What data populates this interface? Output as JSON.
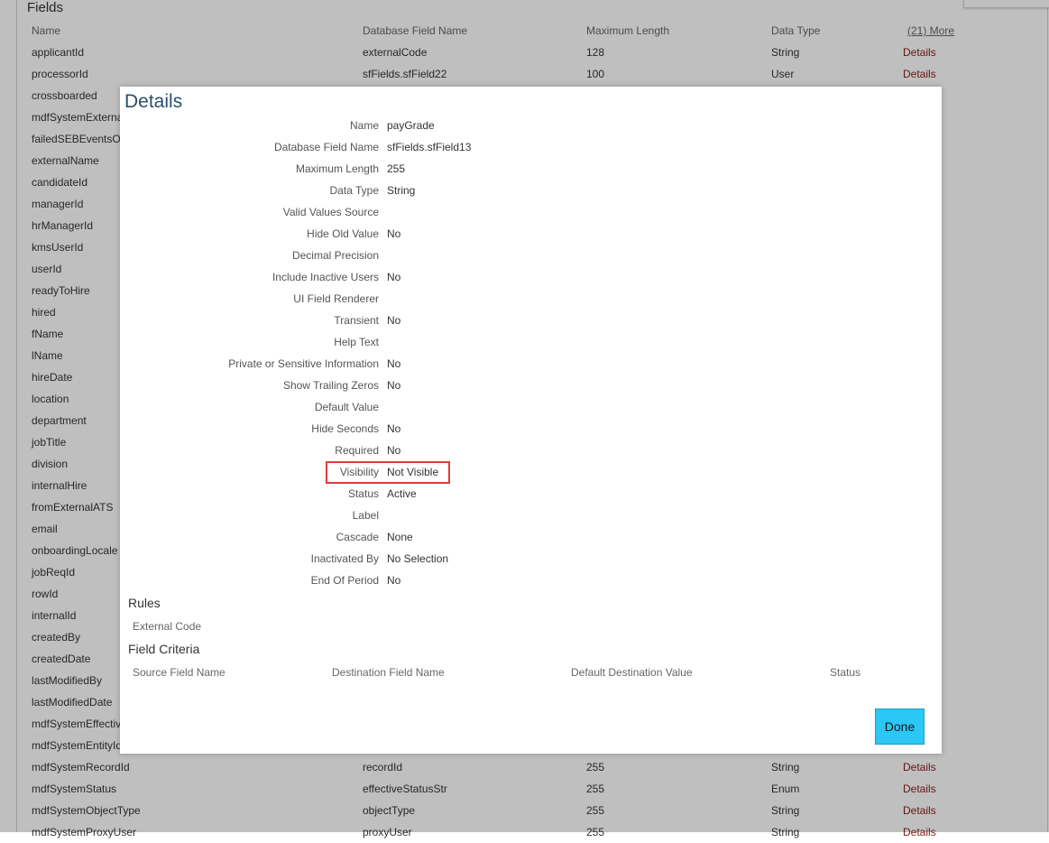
{
  "page": {
    "fields_title": "Fields",
    "headers": {
      "name": "Name",
      "db": "Database Field Name",
      "len": "Maximum Length",
      "type": "Data Type",
      "more": "(21) More"
    },
    "rows": [
      {
        "name": "applicantId",
        "db": "externalCode",
        "len": "128",
        "type": "String",
        "det": "Details"
      },
      {
        "name": "processorId",
        "db": "sfFields.sfField22",
        "len": "100",
        "type": "User",
        "det": "Details"
      },
      {
        "name": "crossboarded",
        "db": "",
        "len": "",
        "type": "",
        "det": ""
      },
      {
        "name": "mdfSystemExterna",
        "db": "",
        "len": "",
        "type": "",
        "det": ""
      },
      {
        "name": "failedSEBEventsOc",
        "db": "",
        "len": "",
        "type": "",
        "det": ""
      },
      {
        "name": "externalName",
        "db": "",
        "len": "",
        "type": "",
        "det": ""
      },
      {
        "name": "candidateId",
        "db": "",
        "len": "",
        "type": "",
        "det": ""
      },
      {
        "name": "managerId",
        "db": "",
        "len": "",
        "type": "",
        "det": ""
      },
      {
        "name": "hrManagerId",
        "db": "",
        "len": "",
        "type": "",
        "det": ""
      },
      {
        "name": "kmsUserId",
        "db": "",
        "len": "",
        "type": "",
        "det": ""
      },
      {
        "name": "userId",
        "db": "",
        "len": "",
        "type": "",
        "det": ""
      },
      {
        "name": "readyToHire",
        "db": "",
        "len": "",
        "type": "",
        "det": ""
      },
      {
        "name": "hired",
        "db": "",
        "len": "",
        "type": "",
        "det": ""
      },
      {
        "name": "fName",
        "db": "",
        "len": "",
        "type": "",
        "det": ""
      },
      {
        "name": "lName",
        "db": "",
        "len": "",
        "type": "",
        "det": ""
      },
      {
        "name": "hireDate",
        "db": "",
        "len": "",
        "type": "",
        "det": ""
      },
      {
        "name": "location",
        "db": "",
        "len": "",
        "type": "",
        "det": ""
      },
      {
        "name": "department",
        "db": "",
        "len": "",
        "type": "",
        "det": ""
      },
      {
        "name": "jobTitle",
        "db": "",
        "len": "",
        "type": "",
        "det": ""
      },
      {
        "name": "division",
        "db": "",
        "len": "",
        "type": "",
        "det": ""
      },
      {
        "name": "internalHire",
        "db": "",
        "len": "",
        "type": "",
        "det": ""
      },
      {
        "name": "fromExternalATS",
        "db": "",
        "len": "",
        "type": "",
        "det": ""
      },
      {
        "name": "email",
        "db": "",
        "len": "",
        "type": "",
        "det": ""
      },
      {
        "name": "onboardingLocale",
        "db": "",
        "len": "",
        "type": "",
        "det": ""
      },
      {
        "name": "jobReqId",
        "db": "",
        "len": "",
        "type": "",
        "det": ""
      },
      {
        "name": "rowId",
        "db": "",
        "len": "",
        "type": "",
        "det": ""
      },
      {
        "name": "internalId",
        "db": "",
        "len": "",
        "type": "",
        "det": ""
      },
      {
        "name": "createdBy",
        "db": "",
        "len": "",
        "type": "",
        "det": ""
      },
      {
        "name": "createdDate",
        "db": "",
        "len": "",
        "type": "",
        "det": ""
      },
      {
        "name": "lastModifiedBy",
        "db": "",
        "len": "",
        "type": "",
        "det": ""
      },
      {
        "name": "lastModifiedDate",
        "db": "",
        "len": "",
        "type": "",
        "det": ""
      },
      {
        "name": "mdfSystemEffectiv",
        "db": "",
        "len": "",
        "type": "",
        "det": ""
      },
      {
        "name": "mdfSystemEntityId",
        "db": "",
        "len": "",
        "type": "",
        "det": ""
      },
      {
        "name": "mdfSystemRecordId",
        "db": "recordId",
        "len": "255",
        "type": "String",
        "det": "Details"
      },
      {
        "name": "mdfSystemStatus",
        "db": "effectiveStatusStr",
        "len": "255",
        "type": "Enum",
        "det": "Details"
      },
      {
        "name": "mdfSystemObjectType",
        "db": "objectType",
        "len": "255",
        "type": "String",
        "det": "Details"
      },
      {
        "name": "mdfSystemProxyUser",
        "db": "proxyUser",
        "len": "255",
        "type": "String",
        "det": "Details"
      }
    ]
  },
  "dialog": {
    "title": "Details",
    "fields": [
      {
        "label": "Name",
        "value": "payGrade"
      },
      {
        "label": "Database Field Name",
        "value": "sfFields.sfField13"
      },
      {
        "label": "Maximum Length",
        "value": "255"
      },
      {
        "label": "Data Type",
        "value": "String"
      },
      {
        "label": "Valid Values Source",
        "value": ""
      },
      {
        "label": "Hide Old Value",
        "value": "No"
      },
      {
        "label": "Decimal Precision",
        "value": ""
      },
      {
        "label": "Include Inactive Users",
        "value": "No"
      },
      {
        "label": "UI Field Renderer",
        "value": ""
      },
      {
        "label": "Transient",
        "value": "No"
      },
      {
        "label": "Help Text",
        "value": ""
      },
      {
        "label": "Private or Sensitive Information",
        "value": "No"
      },
      {
        "label": "Show Trailing Zeros",
        "value": "No"
      },
      {
        "label": "Default Value",
        "value": ""
      },
      {
        "label": "Hide Seconds",
        "value": "No"
      },
      {
        "label": "Required",
        "value": "No"
      },
      {
        "label": "Visibility",
        "value": "Not Visible"
      },
      {
        "label": "Status",
        "value": "Active"
      },
      {
        "label": "Label",
        "value": ""
      },
      {
        "label": "Cascade",
        "value": "None"
      },
      {
        "label": "Inactivated By",
        "value": "No Selection"
      },
      {
        "label": "End Of Period",
        "value": "No"
      }
    ],
    "rules_title": "Rules",
    "rules_col": "External Code",
    "criteria_title": "Field Criteria",
    "criteria_cols": [
      "Source Field Name",
      "Destination Field Name",
      "Default Destination Value",
      "Status"
    ],
    "done_label": "Done"
  },
  "colors": {
    "accent": "#2bc7f5",
    "title": "#2a4e6b",
    "details_link": "#8b1a1a",
    "highlight": "#e03b3b"
  }
}
